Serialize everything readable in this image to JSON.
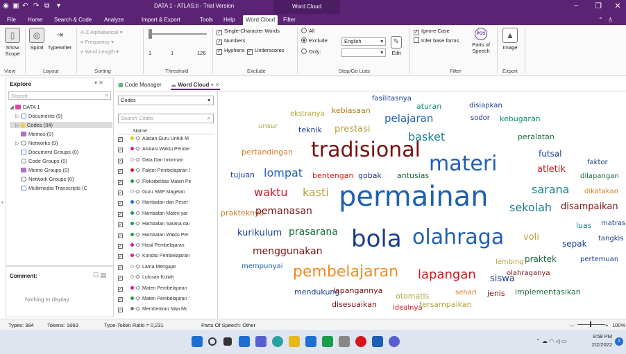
{
  "titlebar": {
    "title": "DATA 1 - ATLAS.ti - Trial Version",
    "context_tab": "Word Cloud"
  },
  "menu": {
    "tabs": [
      "File",
      "Home",
      "Search & Code",
      "Analyze",
      "Import & Export",
      "Tools",
      "Help",
      "Word Cloud",
      "Filter"
    ]
  },
  "ribbon": {
    "view": {
      "show_scope": "Show Scope",
      "label": "View"
    },
    "layout": {
      "spiral": "Spiral",
      "typewriter": "Typewriter",
      "label": "Layout"
    },
    "sorting": {
      "alphabetical": "Alphabetical",
      "frequency": "Frequency",
      "word_length": "Word Length",
      "label": "Sorting"
    },
    "threshold": {
      "min": "1",
      "cur": "1",
      "max": "126",
      "label": "Threshold"
    },
    "exclude": {
      "single_char": "Single-Character Words",
      "numbers": "Numbers",
      "hyphens": "Hyphens",
      "underscores": "Underscores",
      "label": "Exclude"
    },
    "stopgo": {
      "all": "All",
      "exclude": "Exclude:",
      "only": "Only:",
      "language": "English",
      "edit": "Edit",
      "label": "Stop/Go Lists"
    },
    "filter": {
      "ignore_case": "Ignore Case",
      "infer_base": "Infer base forms",
      "parts_of_speech": "Parts of Speech",
      "pos_badge": "POS",
      "label": "Filter"
    },
    "export": {
      "image": "Image",
      "label": "Export"
    }
  },
  "explore": {
    "title": "Explore",
    "search_placeholder": "Search",
    "items": [
      {
        "label": "DATA 1"
      },
      {
        "label": "Documents (9)"
      },
      {
        "label": "Codes (34)"
      },
      {
        "label": "Memos (0)"
      },
      {
        "label": "Networks (9)"
      },
      {
        "label": "Document Groups (0)"
      },
      {
        "label": "Code Groups (0)"
      },
      {
        "label": "Memo Groups (0)"
      },
      {
        "label": "Network Groups (0)"
      },
      {
        "label": "Multimedia Transcripts (C"
      }
    ]
  },
  "comment": {
    "title": "Comment:",
    "empty": "Nothing to display."
  },
  "doctabs": {
    "code_manager": "Code Manager",
    "word_cloud": "Word Cloud"
  },
  "codes": {
    "select": "Codes",
    "search_placeholder": "Search Codes",
    "col_name": "Name",
    "rows": [
      {
        "label": "Alasan Guru Untuk M",
        "color": "#e6c619"
      },
      {
        "label": "Alokasi Waktu Pembe",
        "color": "#e0168f"
      },
      {
        "label": "Data Dari Informan",
        "color": "#ffffff"
      },
      {
        "label": "Faktor Pembelajaran I",
        "color": "#d8141c"
      },
      {
        "label": "Fleksibelitas Materi Pe",
        "color": "#1a9c4b"
      },
      {
        "label": "Guru SMP Magetan",
        "color": "#ffffff"
      },
      {
        "label": "Hambatan dari Peser",
        "color": "#1f6fd0"
      },
      {
        "label": "Hambatan Materi yar",
        "color": "#1a9c4b"
      },
      {
        "label": "Hambatan Sarana dai",
        "color": "#1a9c4b"
      },
      {
        "label": "Hambatan Waktu Per",
        "color": "#1a9c4b"
      },
      {
        "label": "Hasil Pembelajaran",
        "color": "#e0168f"
      },
      {
        "label": "Kondisi Pembelajaran",
        "color": "#e0168f"
      },
      {
        "label": "Lama Mengajar",
        "color": "#ffffff"
      },
      {
        "label": "Lulusan Kuliah",
        "color": "#ffffff"
      },
      {
        "label": "Materi Pembelajaran",
        "color": "#e0168f"
      },
      {
        "label": "Materi Pembelajaran '",
        "color": "#1a9c4b"
      },
      {
        "label": "Memberikan Nilai Mc",
        "color": "#777777"
      }
    ]
  },
  "cloud": {
    "words": [
      {
        "t": "fasilitasnya",
        "c": "#1a3c8c",
        "s": 10
      },
      {
        "t": "aturan",
        "c": "#0f8a6f",
        "s": 11
      },
      {
        "t": "disiapkan",
        "c": "#1a3c8c",
        "s": 10
      },
      {
        "t": "ekstranya",
        "c": "#b3a339",
        "s": 10
      },
      {
        "t": "kebiasaan",
        "c": "#b07d10",
        "s": 11
      },
      {
        "t": "pelajaran",
        "c": "#1f5fb4",
        "s": 15
      },
      {
        "t": "sodor",
        "c": "#1a3c8c",
        "s": 10
      },
      {
        "t": "kebugaran",
        "c": "#0f8a6f",
        "s": 11
      },
      {
        "t": "unsur",
        "c": "#b3a339",
        "s": 10
      },
      {
        "t": "teknik",
        "c": "#1a3c8c",
        "s": 11
      },
      {
        "t": "prestasi",
        "c": "#b3a339",
        "s": 13
      },
      {
        "t": "basket",
        "c": "#1a7f8c",
        "s": 16
      },
      {
        "t": "peralatan",
        "c": "#1a6b3a",
        "s": 11
      },
      {
        "t": "pertandingan",
        "c": "#d97a1f",
        "s": 11
      },
      {
        "t": "tradisional",
        "c": "#7a1010",
        "s": 30
      },
      {
        "t": "materi",
        "c": "#1f5fb4",
        "s": 30
      },
      {
        "t": "futsal",
        "c": "#1a3c8c",
        "s": 12
      },
      {
        "t": "faktor",
        "c": "#1a3c8c",
        "s": 10
      },
      {
        "t": "tujuan",
        "c": "#1a3c8c",
        "s": 11
      },
      {
        "t": "lompat",
        "c": "#1f5fb4",
        "s": 16
      },
      {
        "t": "bentengan",
        "c": "#d8141c",
        "s": 11
      },
      {
        "t": "gobak",
        "c": "#1a3c8c",
        "s": 11
      },
      {
        "t": "antusias",
        "c": "#1a6b3a",
        "s": 11
      },
      {
        "t": "atletik",
        "c": "#d8141c",
        "s": 13
      },
      {
        "t": "dilapangan",
        "c": "#1a6b3a",
        "s": 10
      },
      {
        "t": "waktu",
        "c": "#d8141c",
        "s": 16
      },
      {
        "t": "kasti",
        "c": "#b3a339",
        "s": 16
      },
      {
        "t": "permainan",
        "c": "#1f5fb4",
        "s": 40
      },
      {
        "t": "sarana",
        "c": "#1a7f8c",
        "s": 16
      },
      {
        "t": "dikatakan",
        "c": "#d97a1f",
        "s": 10
      },
      {
        "t": "sekolah",
        "c": "#1a7f8c",
        "s": 16
      },
      {
        "t": "disampaikan",
        "c": "#7a1010",
        "s": 13
      },
      {
        "t": "prakteknya",
        "c": "#d97a1f",
        "s": 11
      },
      {
        "t": "pemanasan",
        "c": "#7a1010",
        "s": 14
      },
      {
        "t": "luas",
        "c": "#1a7f8c",
        "s": 11
      },
      {
        "t": "matras",
        "c": "#1a3c8c",
        "s": 10
      },
      {
        "t": "kurikulum",
        "c": "#1a3c8c",
        "s": 13
      },
      {
        "t": "prasarana",
        "c": "#1a6b3a",
        "s": 14
      },
      {
        "t": "bola",
        "c": "#1a3c8c",
        "s": 34
      },
      {
        "t": "olahraga",
        "c": "#1f5fb4",
        "s": 30
      },
      {
        "t": "voli",
        "c": "#b3a339",
        "s": 13
      },
      {
        "t": "sepak",
        "c": "#1a3c8c",
        "s": 12
      },
      {
        "t": "tangkis",
        "c": "#1a3c8c",
        "s": 10
      },
      {
        "t": "menggunakan",
        "c": "#7a1010",
        "s": 14
      },
      {
        "t": "lembing",
        "c": "#b3a339",
        "s": 10
      },
      {
        "t": "praktek",
        "c": "#1a6b3a",
        "s": 12
      },
      {
        "t": "pertemuan",
        "c": "#1a3c8c",
        "s": 10
      },
      {
        "t": "mempunyai",
        "c": "#1f5fb4",
        "s": 10
      },
      {
        "t": "pembelajaran",
        "c": "#f08a1f",
        "s": 22
      },
      {
        "t": "lapangan",
        "c": "#d8141c",
        "s": 18
      },
      {
        "t": "siswa",
        "c": "#1a3c8c",
        "s": 13
      },
      {
        "t": "olahraganya",
        "c": "#7a1010",
        "s": 10
      },
      {
        "t": "mendukung",
        "c": "#1a3c8c",
        "s": 11
      },
      {
        "t": "lapangannya",
        "c": "#7a1010",
        "s": 11
      },
      {
        "t": "otomatis",
        "c": "#b3a339",
        "s": 11
      },
      {
        "t": "sehari",
        "c": "#d97a1f",
        "s": 10
      },
      {
        "t": "jenis",
        "c": "#7a1010",
        "s": 11
      },
      {
        "t": "implementasikan",
        "c": "#1a6b3a",
        "s": 11
      },
      {
        "t": "disesuaikan",
        "c": "#7a1010",
        "s": 11
      },
      {
        "t": "idealnya",
        "c": "#d8141c",
        "s": 10
      },
      {
        "t": "tersampaikan",
        "c": "#b3a339",
        "s": 11
      }
    ]
  },
  "status": {
    "types": "Types: 384",
    "tokens": "Tokens: 1660",
    "ttr": "Type-Token Ratio = 0,231",
    "pos": "Parts Of Speech: Other",
    "zoom": "100%"
  },
  "taskbar": {
    "time": "9:58 PM",
    "date": "2/2/2022"
  },
  "colors": {
    "brand": "#5b2374"
  }
}
